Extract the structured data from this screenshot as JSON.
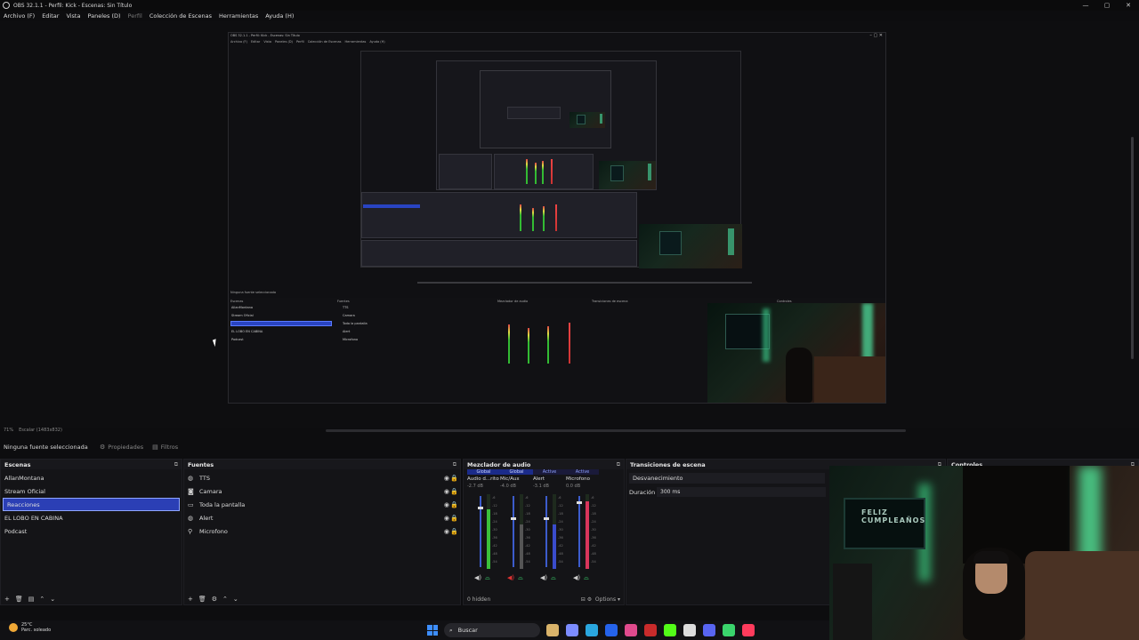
{
  "window": {
    "title": "OBS 32.1.1 - Perfil: Kick - Escenas: Sin Título",
    "controls": [
      "—",
      "▢",
      "✕"
    ]
  },
  "menu": [
    "Archivo (F)",
    "Editar",
    "Vista",
    "Paneles (D)",
    "Perfil",
    "Colección de Escenas",
    "Herramientas",
    "Ayuda (H)"
  ],
  "preview": {
    "zoom_label": "71%",
    "scale_label": "Escalar (1483x832)"
  },
  "source_toolbar": {
    "no_source": "Ninguna fuente seleccionada",
    "properties": "Propiedades",
    "filters": "Filtros"
  },
  "scenes": {
    "title": "Escenas",
    "items": [
      "AllanMontana",
      "Stream Oficial",
      "Reacciones",
      "EL LOBO EN CABINA",
      "Podcast"
    ],
    "selected_index": 2
  },
  "sources": {
    "title": "Fuentes",
    "items": [
      {
        "name": "TTS",
        "icon": "globe-icon"
      },
      {
        "name": "Camara",
        "icon": "camera-icon"
      },
      {
        "name": "Toda la pantalla",
        "icon": "monitor-icon"
      },
      {
        "name": "Alert",
        "icon": "globe-icon"
      },
      {
        "name": "Microfono",
        "icon": "microphone-icon"
      }
    ]
  },
  "mixer": {
    "title": "Mezclador de audio",
    "tabs": [
      "Global",
      "Global",
      "Active",
      "Active"
    ],
    "channels": [
      {
        "name": "Audio d...ritorio",
        "db": "-2.7 dB",
        "level": 0.8,
        "color": "#3bbf3b"
      },
      {
        "name": "Mic/Aux",
        "db": "-4.0 dB",
        "level": 0.6,
        "color": "#555555"
      },
      {
        "name": "Alert",
        "db": "-3.1 dB",
        "level": 0.6,
        "color": "#3a4ccc"
      },
      {
        "name": "Microfono",
        "db": "0.0 dB",
        "level": 0.9,
        "color": "#d8355b"
      }
    ],
    "hidden": "0 hidden",
    "options": "Options"
  },
  "transitions": {
    "title": "Transiciones de escena",
    "selected": "Desvanecimiento",
    "duration_label": "Duración",
    "duration_value": "300 ms"
  },
  "controls": {
    "title": "Controles"
  },
  "webcam": {
    "monitor_text": "FELIZ CUMPLEAÑOS"
  },
  "taskbar": {
    "temp": "25°C",
    "weather": "Parc. soleado",
    "search": "Buscar",
    "app_colors": [
      "#d9b36a",
      "#7c8cff",
      "#2aa7e0",
      "#2563eb",
      "#e04a8d",
      "#c92b2b",
      "#53fc18",
      "#dddddd",
      "#5865f2",
      "#3ad46c",
      "#ff3b5c"
    ]
  }
}
